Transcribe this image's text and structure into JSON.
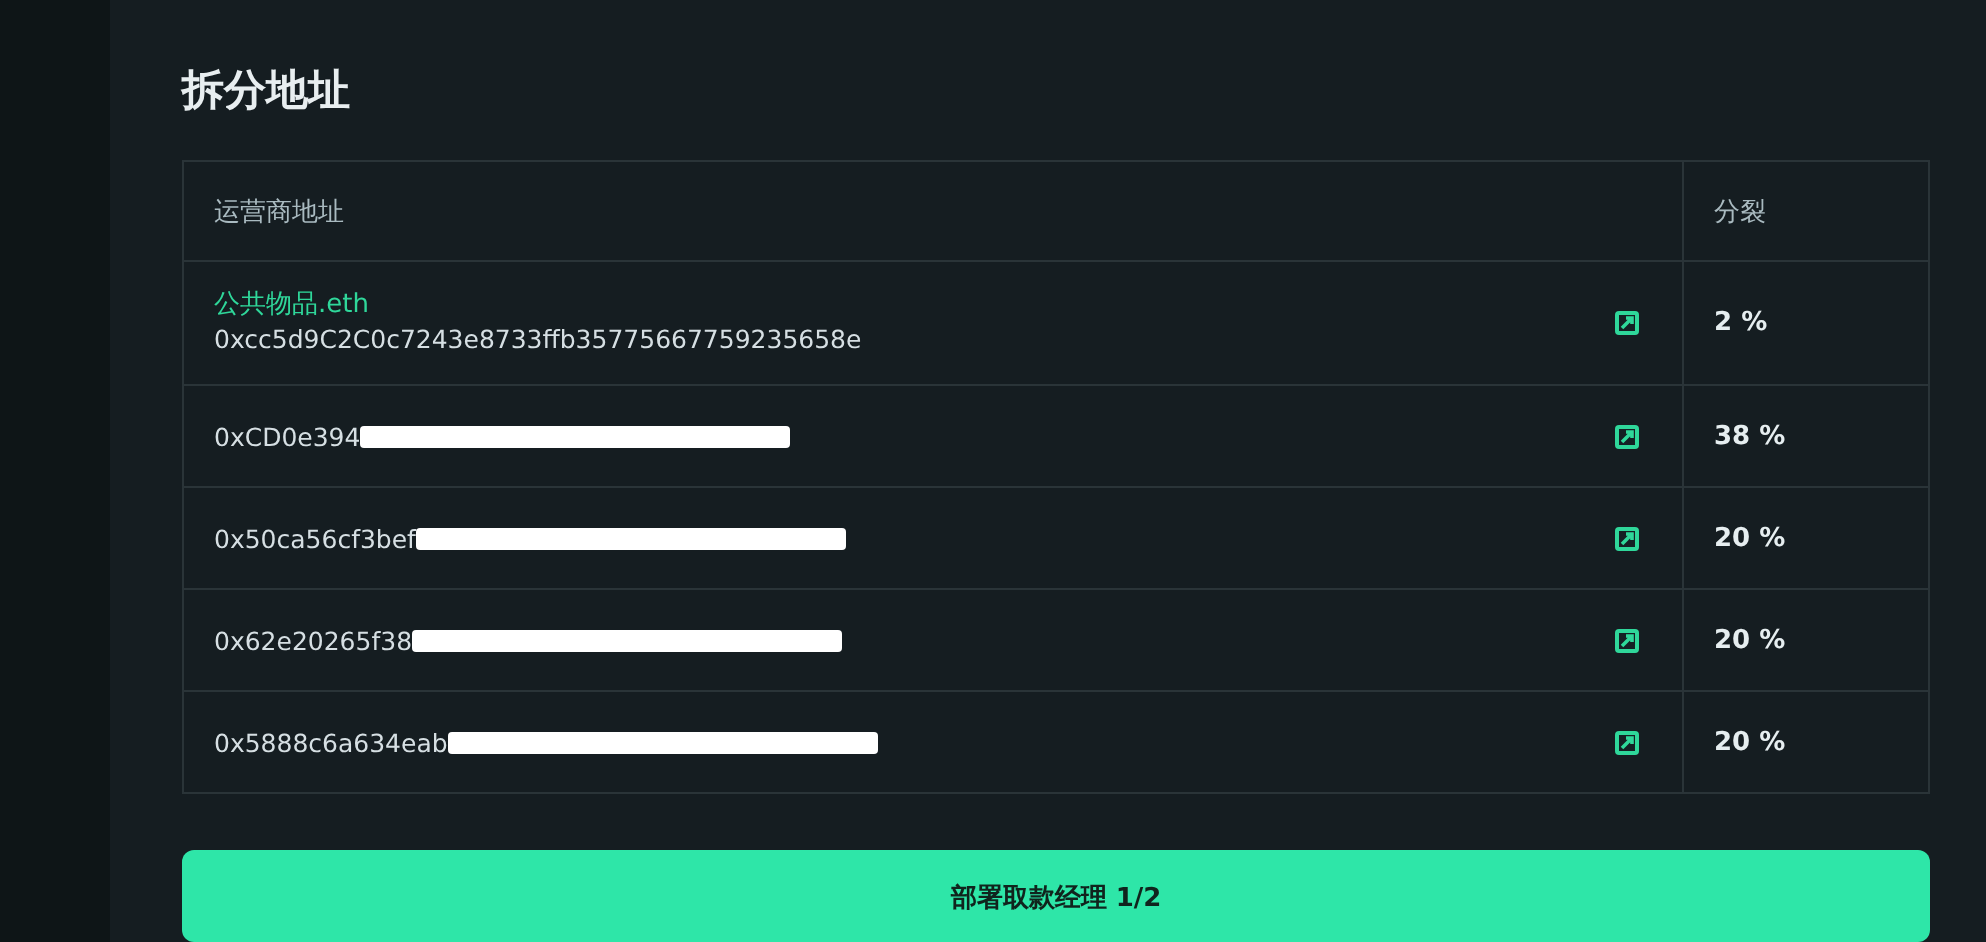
{
  "section_title": "拆分地址",
  "table": {
    "columns": [
      "运营商地址",
      "分裂"
    ],
    "rows": [
      {
        "name": "公共物品.eth",
        "address": "0xcc5d9C2C0c7243e8733ffb35775667759235658e",
        "redacted": false,
        "split": "2 %"
      },
      {
        "address": "0xCD0e394",
        "redacted": true,
        "split": "38 %"
      },
      {
        "address": "0x50ca56cf3bef",
        "redacted": true,
        "split": "20 %"
      },
      {
        "address": "0x62e20265f38",
        "redacted": true,
        "split": "20 %"
      },
      {
        "address": "0x5888c6a634eab",
        "redacted": true,
        "split": "20 %"
      }
    ]
  },
  "primary_button": "部署取款经理 1/2"
}
